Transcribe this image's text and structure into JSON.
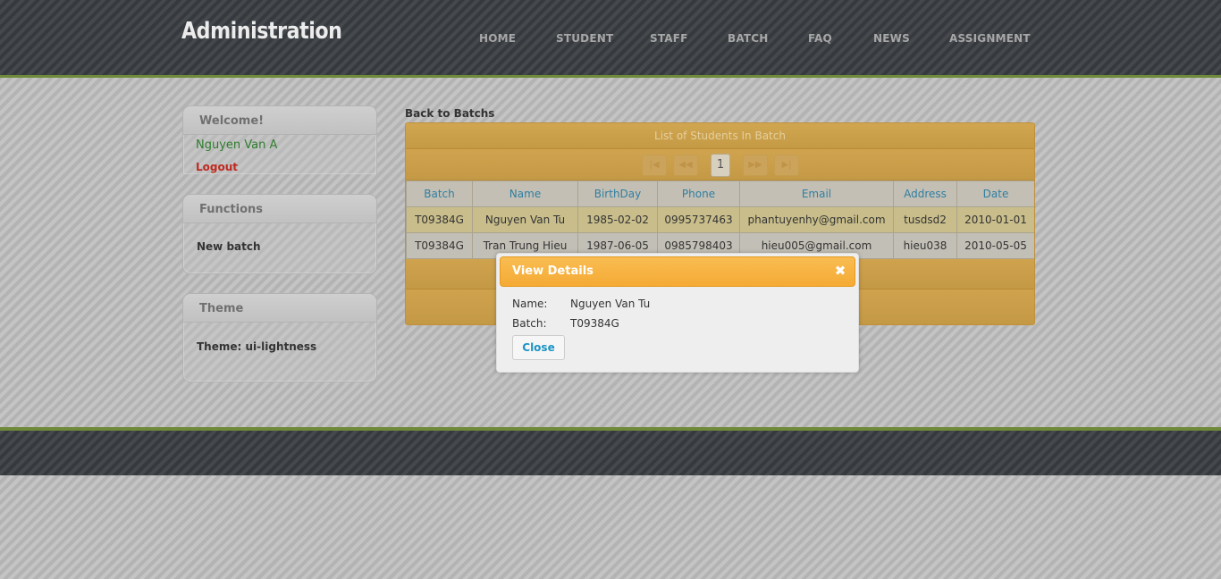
{
  "header": {
    "logo": "Administration",
    "nav": [
      {
        "label": "HOME"
      },
      {
        "label": "STUDENT"
      },
      {
        "label": "STAFF"
      },
      {
        "label": "BATCH"
      },
      {
        "label": "FAQ"
      },
      {
        "label": "NEWS"
      },
      {
        "label": "ASSIGNMENT"
      }
    ]
  },
  "sidebar": {
    "welcome": {
      "title": "Welcome!",
      "user": "Nguyen Van A",
      "logout": "Logout"
    },
    "functions": {
      "title": "Functions",
      "items": [
        "New batch"
      ]
    },
    "theme": {
      "title": "Theme",
      "value": "Theme: ui-lightness"
    }
  },
  "main": {
    "back_link": "Back to Batchs",
    "grid": {
      "caption": "List of Students In Batch",
      "pager": {
        "current_page": "1"
      },
      "columns": [
        "Batch",
        "Name",
        "BirthDay",
        "Phone",
        "Email",
        "Address",
        "Date"
      ],
      "rows": [
        [
          "T09384G",
          "Nguyen Van Tu",
          "1985-02-02",
          "0995737463",
          "phantuyenhy@gmail.com",
          "tusdsd2",
          "2010-01-01"
        ],
        [
          "T09384G",
          "Tran Trung Hieu",
          "1987-06-05",
          "0985798403",
          "hieu005@gmail.com",
          "hieu038",
          "2010-05-05"
        ]
      ]
    }
  },
  "dialog": {
    "title": "View Details",
    "close_glyph": "✖",
    "fields": [
      {
        "label": "Name:",
        "value": "Nguyen Van Tu"
      },
      {
        "label": "Batch:",
        "value": "T09384G"
      }
    ],
    "close_button": "Close"
  }
}
